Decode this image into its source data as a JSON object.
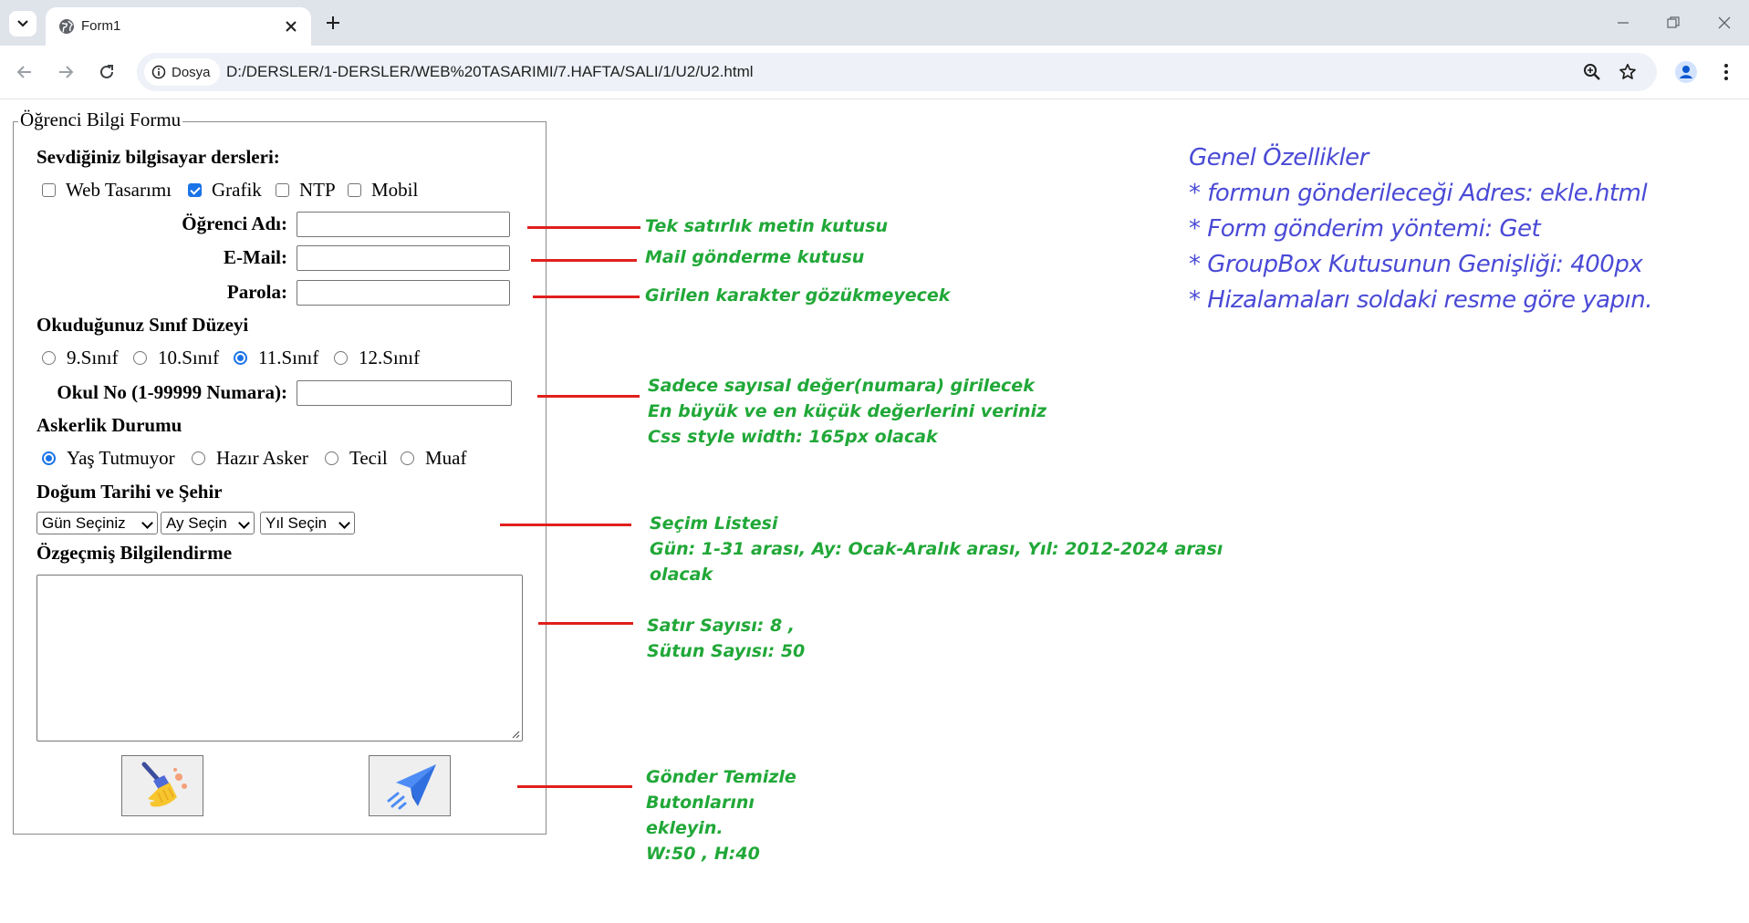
{
  "browser": {
    "tab_title": "Form1",
    "site_chip": "Dosya",
    "url": "D:/DERSLER/1-DERSLER/WEB%20TASARIMI/7.HAFTA/SALI/1/U2/U2.html"
  },
  "form": {
    "legend": "Öğrenci Bilgi Formu",
    "courses_heading": "Sevdiğiniz bilgisayar dersleri:",
    "courses": [
      {
        "label": "Web Tasarımı",
        "checked": false
      },
      {
        "label": "Grafik",
        "checked": true
      },
      {
        "label": "NTP",
        "checked": false
      },
      {
        "label": "Mobil",
        "checked": false
      }
    ],
    "name_label": "Öğrenci Adı:",
    "email_label": "E-Mail:",
    "password_label": "Parola:",
    "class_heading": "Okuduğunuz Sınıf Düzeyi",
    "classes": [
      {
        "label": "9.Sınıf",
        "checked": false
      },
      {
        "label": "10.Sınıf",
        "checked": false
      },
      {
        "label": "11.Sınıf",
        "checked": true
      },
      {
        "label": "12.Sınıf",
        "checked": false
      }
    ],
    "school_no_label": "Okul No (1-99999 Numara):",
    "military_heading": "Askerlik Durumu",
    "military": [
      {
        "label": "Yaş Tutmuyor",
        "checked": true
      },
      {
        "label": "Hazır Asker",
        "checked": false
      },
      {
        "label": "Tecil",
        "checked": false
      },
      {
        "label": "Muaf",
        "checked": false
      }
    ],
    "birth_heading": "Doğum Tarihi ve Şehir",
    "selects": {
      "day": "Gün Seçiniz",
      "month": "Ay Seçin",
      "year": "Yıl Seçin"
    },
    "bio_heading": "Özgeçmiş Bilgilendirme"
  },
  "annotations": {
    "textbox": "Tek satırlık metin kutusu",
    "mail": "Mail gönderme kutusu",
    "password": "Girilen karakter gözükmeyecek",
    "number": [
      "Sadece sayısal değer(numara) girilecek",
      "En büyük ve en küçük değerlerini veriniz",
      "Css style width: 165px olacak"
    ],
    "select": [
      "Seçim Listesi",
      "Gün: 1-31 arası, Ay: Ocak-Aralık arası, Yıl: 2012-2024 arası",
      "olacak"
    ],
    "textarea": [
      "Satır Sayısı: 8 ,",
      "Sütun Sayısı: 50"
    ],
    "buttons": [
      "Gönder Temizle",
      "Butonlarını",
      "ekleyin.",
      "W:50 , H:40"
    ]
  },
  "general": {
    "title": "Genel Özellikler",
    "items": [
      "* formun gönderileceği Adres: ekle.html",
      "* Form gönderim yöntemi: Get",
      "* GroupBox Kutusunun Genişliği: 400px",
      "* Hizalamaları soldaki resme göre yapın."
    ]
  },
  "colors": {
    "annotation_green": "#21a838",
    "annotation_line_red": "#e0201c",
    "general_blue": "#4a4ad6",
    "accent_blue": "#1a73e8"
  }
}
